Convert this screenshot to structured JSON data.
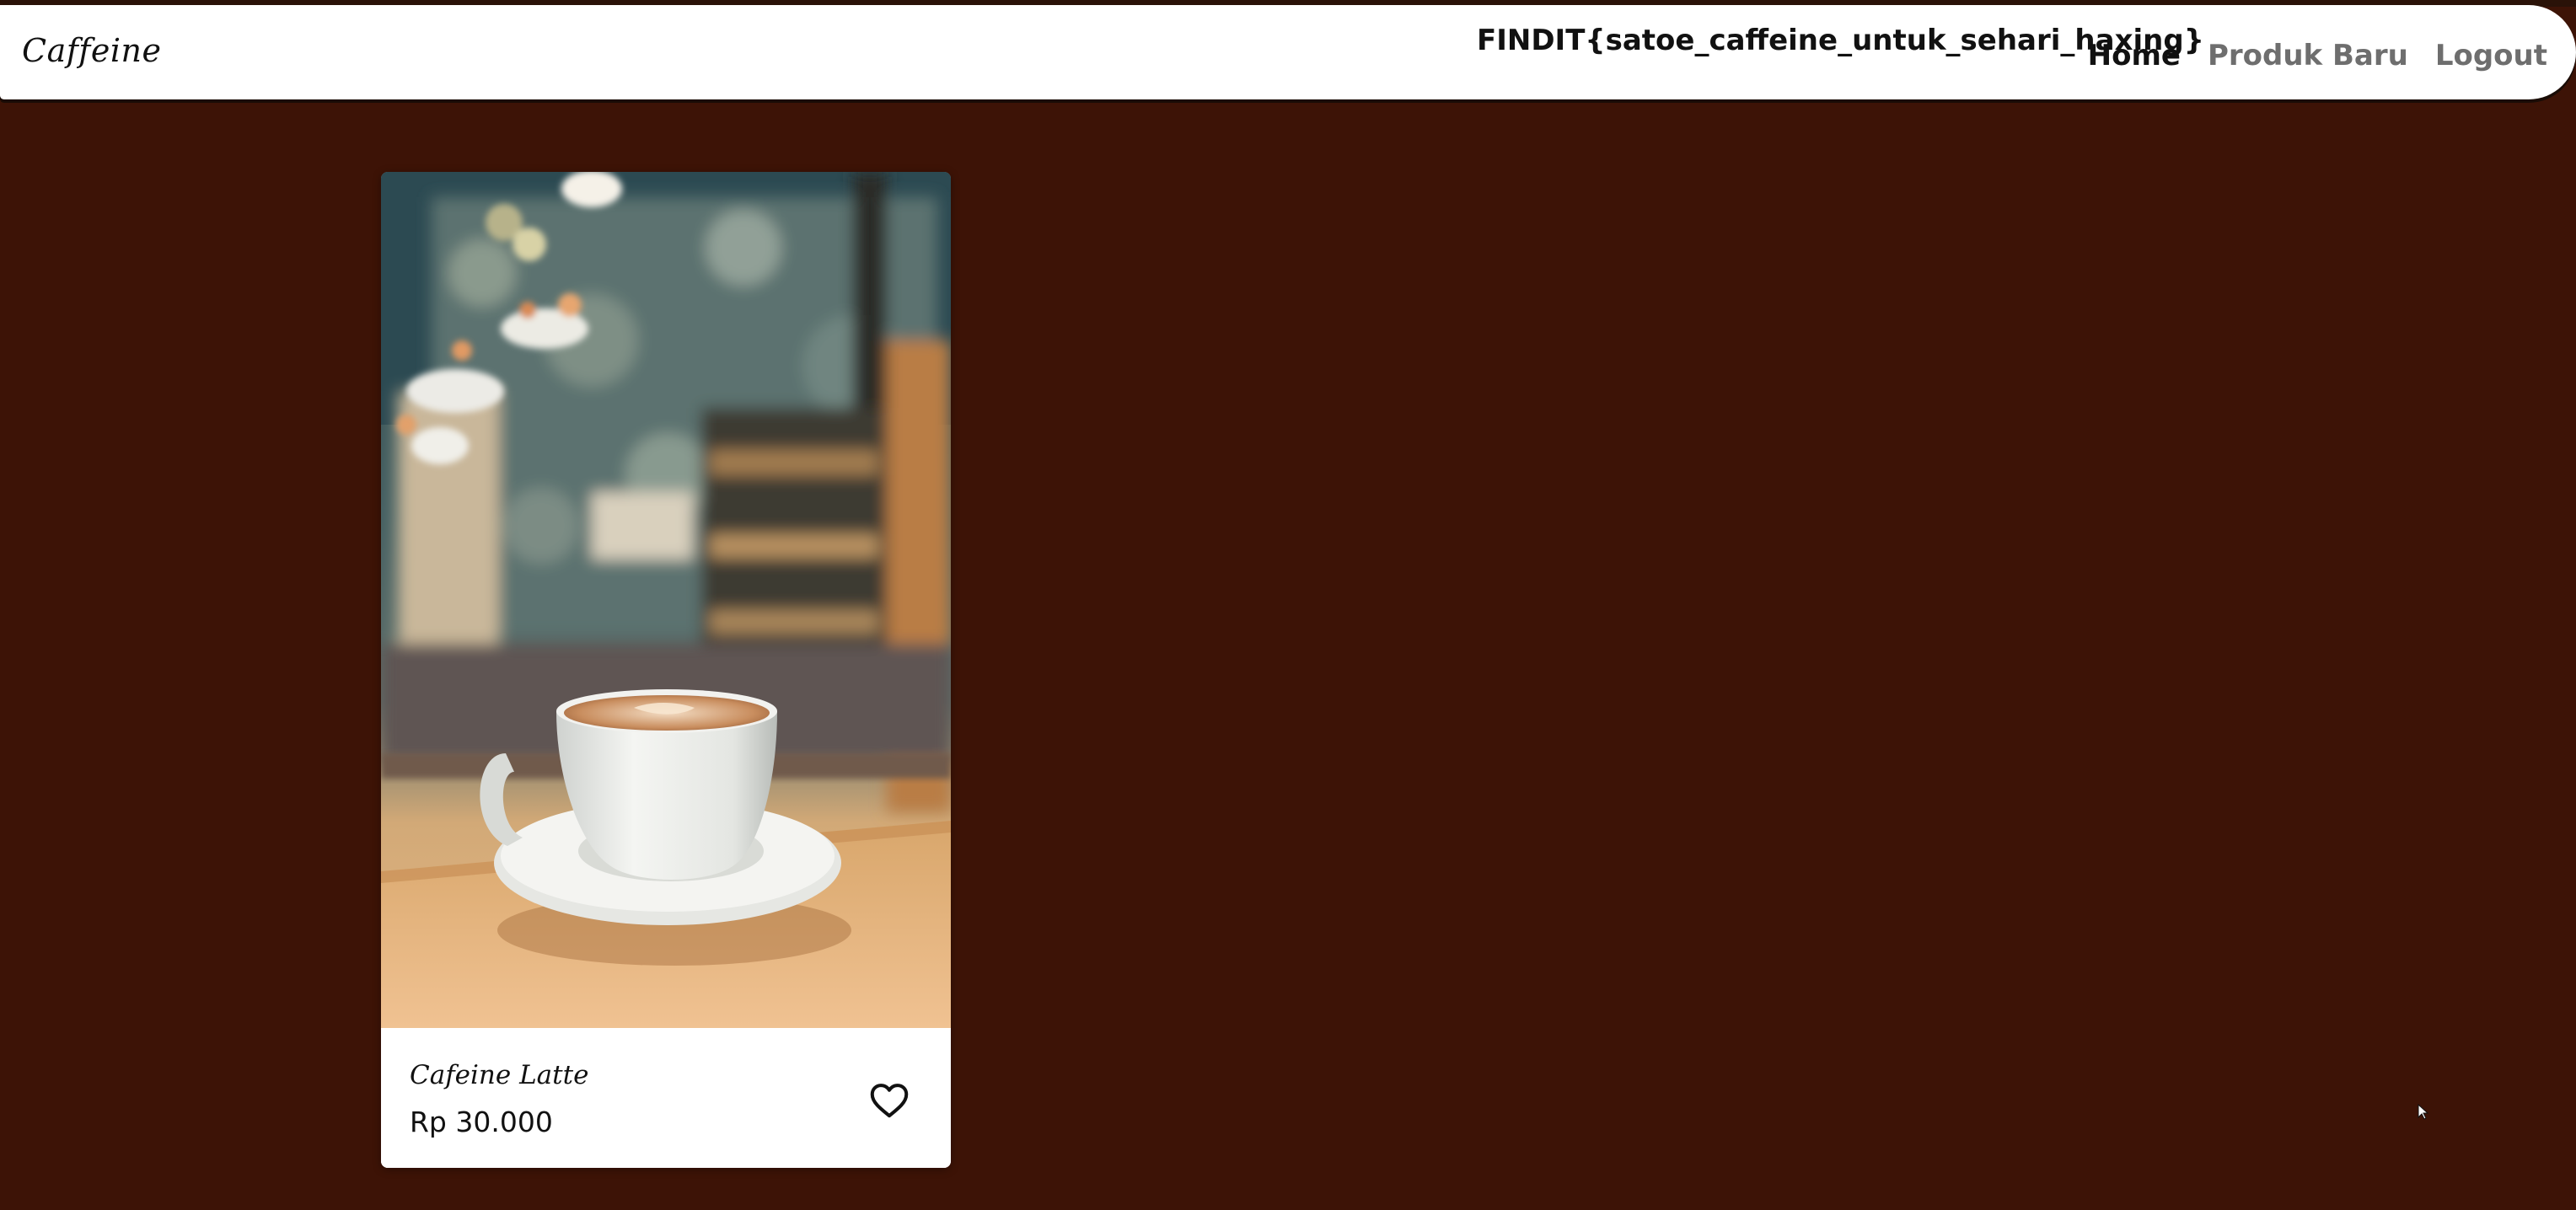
{
  "navbar": {
    "brand": "Caffeine",
    "flag": "FINDIT{satoe_caffeine_untuk_sehari_haxing}",
    "links": [
      {
        "label": "Home",
        "active": true
      },
      {
        "label": "Produk Baru",
        "active": false
      },
      {
        "label": "Logout",
        "active": false
      }
    ]
  },
  "products": [
    {
      "name": "Cafeine Latte",
      "price": "Rp 30.000",
      "image": "cafe-latte-photo",
      "icon": "heart-icon"
    }
  ],
  "colors": {
    "background": "#3d1306",
    "navbar": "#ffffff",
    "active_link": "#111111",
    "inactive_link": "#6e6e6e"
  }
}
